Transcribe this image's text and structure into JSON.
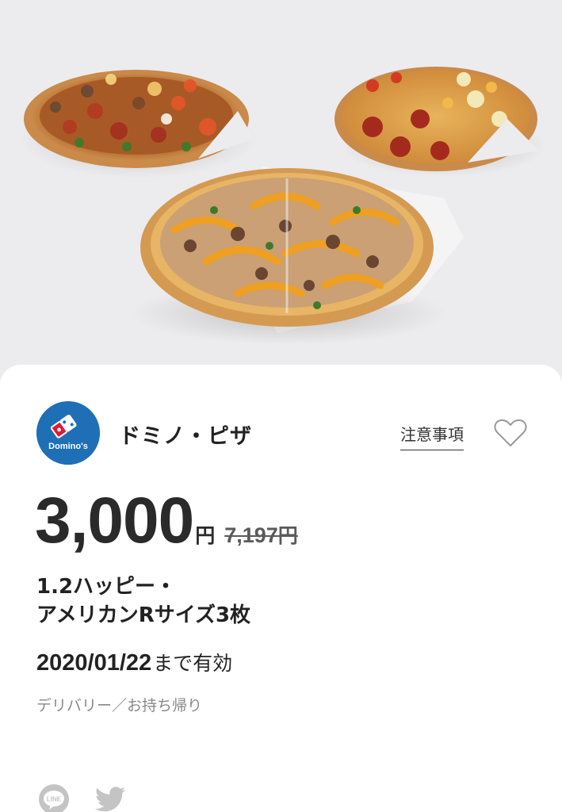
{
  "hero": {
    "image_description_icon": "pizza-photo"
  },
  "shop": {
    "name": "ドミノ・ピザ",
    "logo_text": "Domino's",
    "logo_icon": "dominos-logo-icon",
    "brand_blue": "#1f6fb6",
    "brand_red": "#e31837"
  },
  "actions": {
    "notes_label": "注意事項",
    "favorite_icon": "heart-outline-icon"
  },
  "price": {
    "value": "3,000",
    "unit": "円",
    "original_value": "7,197",
    "original_unit": "円"
  },
  "product": {
    "name_line1": "1.2ハッピー・",
    "name_line2": "アメリカンRサイズ3枚"
  },
  "validity": {
    "date": "2020/01/22",
    "suffix": "まで有効"
  },
  "usage": {
    "text": "デリバリー／お持ち帰り"
  },
  "share": {
    "line_label": "LINE",
    "line_icon": "line-icon",
    "twitter_icon": "twitter-icon"
  }
}
